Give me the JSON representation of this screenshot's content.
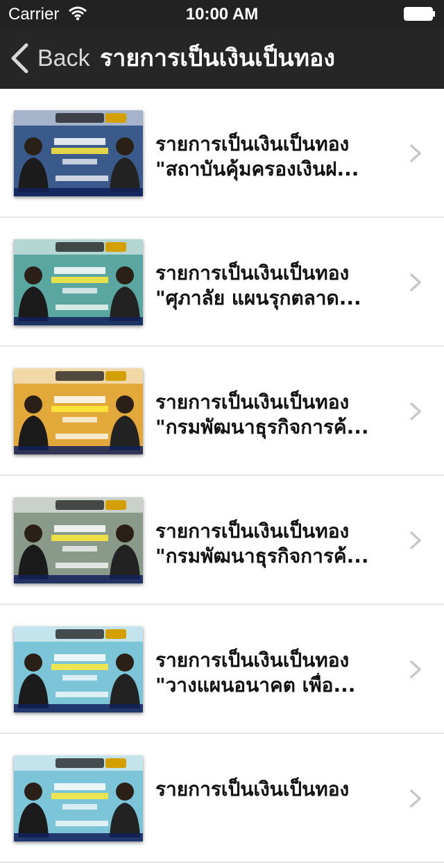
{
  "status": {
    "carrier": "Carrier",
    "time": "10:00 AM"
  },
  "nav": {
    "back_label": "Back",
    "title": "รายการเป็นเงินเป็นทอง"
  },
  "items": [
    {
      "line1": "รายการเป็นเงินเป็นทอง",
      "line2": "\"สถาบันคุ้มครองเงินฝ...",
      "theme": "#3a5a8c"
    },
    {
      "line1": "รายการเป็นเงินเป็นทอง",
      "line2": "\"ศุภาลัย แผนรุกตลาด...",
      "theme": "#5aa6a0"
    },
    {
      "line1": "รายการเป็นเงินเป็นทอง",
      "line2": "\"กรมพัฒนาธุรกิจการค้...",
      "theme": "#e3a83a"
    },
    {
      "line1": "รายการเป็นเงินเป็นทอง",
      "line2": "\"กรมพัฒนาธุรกิจการค้...",
      "theme": "#8a9a8a"
    },
    {
      "line1": "รายการเป็นเงินเป็นทอง",
      "line2": "\"วางแผนอนาคต เพื่อ...",
      "theme": "#7cc4d8"
    },
    {
      "line1": "รายการเป็นเงินเป็นทอง",
      "line2": "",
      "theme": "#7cc4d8"
    }
  ]
}
